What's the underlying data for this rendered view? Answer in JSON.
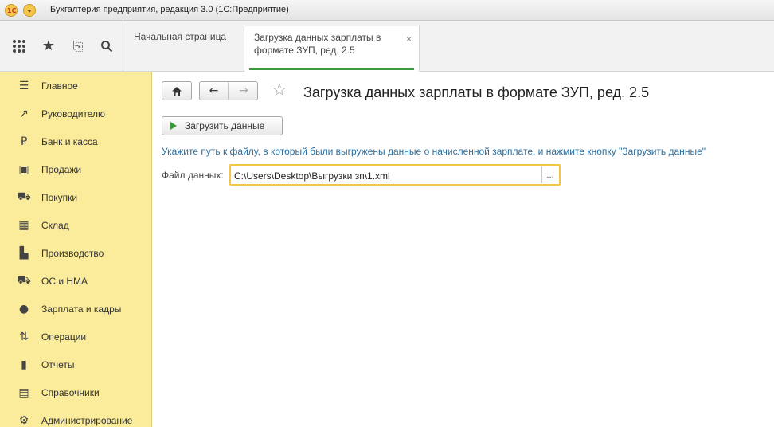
{
  "window": {
    "title": "Бухгалтерия предприятия, редакция 3.0  (1С:Предприятие)",
    "logo_text": "1С"
  },
  "toolbar": {
    "icons": [
      "apps-grid-icon",
      "favorites-star-icon",
      "history-icon",
      "search-icon"
    ]
  },
  "tabs": [
    {
      "label": "Начальная страница",
      "active": false
    },
    {
      "label": "Загрузка данных зарплаты в формате ЗУП, ред. 2.5",
      "active": true
    }
  ],
  "tab_close_glyph": "×",
  "sidebar": {
    "items": [
      {
        "label": "Главное",
        "icon": "menu-lines-icon",
        "glyph": "☰"
      },
      {
        "label": "Руководителю",
        "icon": "trend-chart-icon",
        "glyph": "↗"
      },
      {
        "label": "Банк и касса",
        "icon": "ruble-coin-icon",
        "glyph": "₽"
      },
      {
        "label": "Продажи",
        "icon": "shopping-bag-icon",
        "glyph": "▣"
      },
      {
        "label": "Покупки",
        "icon": "shopping-cart-icon",
        "glyph": "⛟"
      },
      {
        "label": "Склад",
        "icon": "warehouse-boxes-icon",
        "glyph": "▦"
      },
      {
        "label": "Производство",
        "icon": "factory-icon",
        "glyph": "▙"
      },
      {
        "label": "ОС и НМА",
        "icon": "truck-icon",
        "glyph": "⛟"
      },
      {
        "label": "Зарплата и кадры",
        "icon": "person-icon",
        "glyph": "●"
      },
      {
        "label": "Операции",
        "icon": "dt-kt-icon",
        "glyph": "⇅"
      },
      {
        "label": "Отчеты",
        "icon": "bar-chart-icon",
        "glyph": "▮"
      },
      {
        "label": "Справочники",
        "icon": "book-icon",
        "glyph": "▤"
      },
      {
        "label": "Администрирование",
        "icon": "gear-icon",
        "glyph": "⚙"
      }
    ]
  },
  "main": {
    "title": "Загрузка данных зарплаты в формате ЗУП, ред. 2.5",
    "load_button": "Загрузить данные",
    "hint": "Укажите путь к файлу, в который были выгружены данные о начисленной зарплате, и нажмите кнопку \"Загрузить данные\"",
    "file_label": "Файл данных:",
    "file_value": "C:\\Users\\Desktop\\Выгрузки зп\\1.xml",
    "browse_label": "..."
  },
  "colors": {
    "sidebar_bg": "#fbec9b",
    "accent_green": "#3a9a3a",
    "field_focus": "#f2c744",
    "hint_text": "#2a6fa0"
  }
}
